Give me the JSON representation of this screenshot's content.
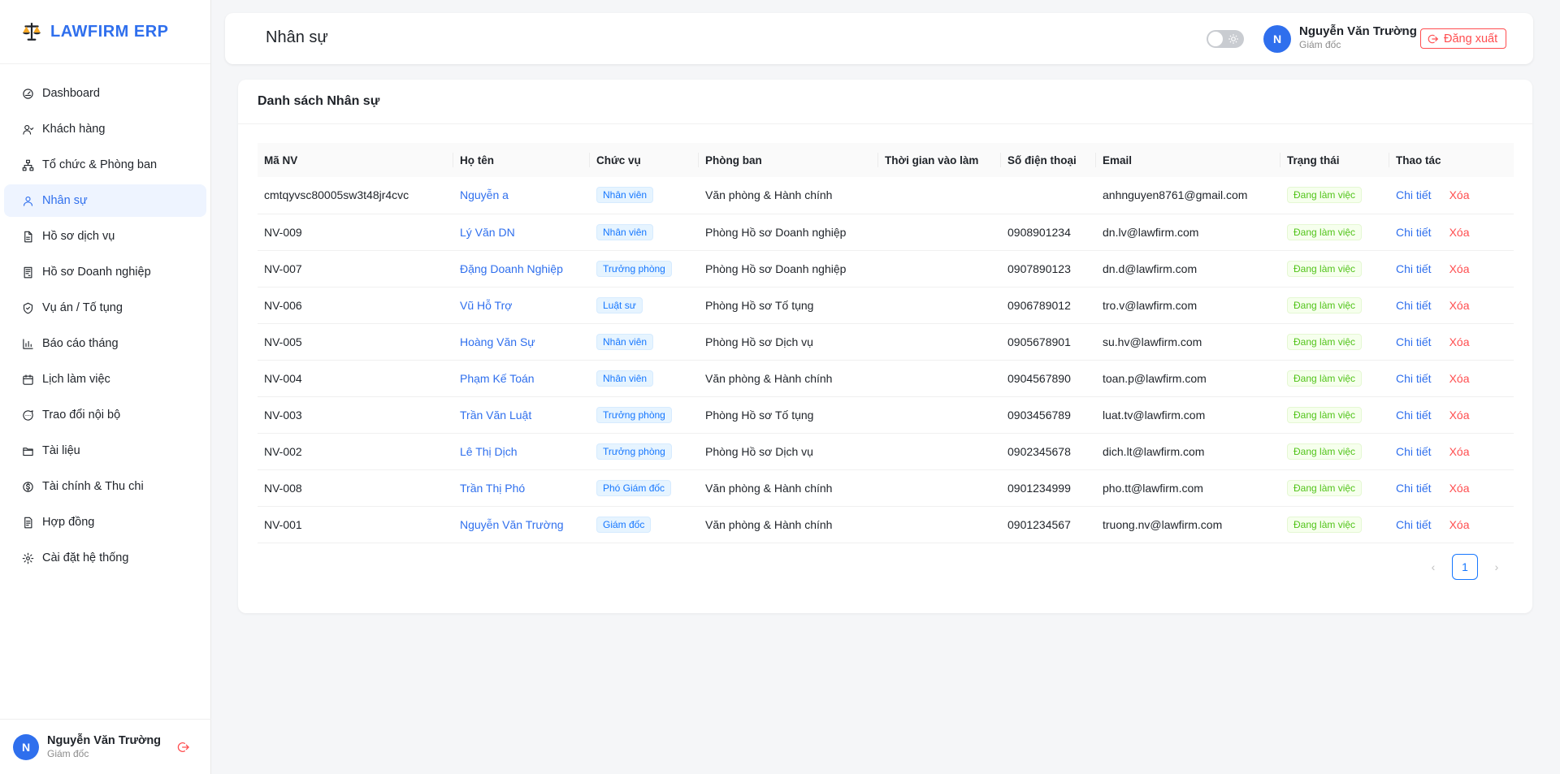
{
  "app": {
    "name": "LAWFIRM ERP"
  },
  "sidebar": {
    "items": [
      {
        "label": "Dashboard",
        "icon": "dashboard-icon"
      },
      {
        "label": "Khách hàng",
        "icon": "customers-icon"
      },
      {
        "label": "Tổ chức & Phòng ban",
        "icon": "org-chart-icon"
      },
      {
        "label": "Nhân sự",
        "icon": "user-icon",
        "active": true
      },
      {
        "label": "Hồ sơ dịch vụ",
        "icon": "file-icon"
      },
      {
        "label": "Hồ sơ Doanh nghiệp",
        "icon": "file-text-icon"
      },
      {
        "label": "Vụ án / Tố tụng",
        "icon": "shield-icon"
      },
      {
        "label": "Báo cáo tháng",
        "icon": "bar-chart-icon"
      },
      {
        "label": "Lịch làm việc",
        "icon": "calendar-icon"
      },
      {
        "label": "Trao đổi nội bộ",
        "icon": "chat-icon"
      },
      {
        "label": "Tài liệu",
        "icon": "folder-icon"
      },
      {
        "label": "Tài chính & Thu chi",
        "icon": "dollar-icon"
      },
      {
        "label": "Hợp đồng",
        "icon": "contract-icon"
      },
      {
        "label": "Cài đặt hệ thống",
        "icon": "settings-icon"
      }
    ],
    "user": {
      "initial": "N",
      "name": "Nguyễn Văn Trường",
      "role": "Giám đốc"
    }
  },
  "header": {
    "title": "Nhân sự",
    "user": {
      "initial": "N",
      "name": "Nguyễn Văn Trường",
      "role": "Giám đốc"
    },
    "logout_label": "Đăng xuất"
  },
  "card": {
    "title": "Danh sách Nhân sự",
    "columns": [
      "Mã NV",
      "Họ tên",
      "Chức vụ",
      "Phòng ban",
      "Thời gian vào làm",
      "Số điện thoại",
      "Email",
      "Trạng thái",
      "Thao tác"
    ],
    "rows": [
      {
        "id": "cmtqyvsc80005sw3t48jr4cvc",
        "name": "Nguyễn a",
        "position": "Nhân viên",
        "department": "Văn phòng & Hành chính",
        "start": "",
        "phone": "",
        "email": "anhnguyen8761@gmail.com",
        "status": "Đang làm việc"
      },
      {
        "id": "NV-009",
        "name": "Lý Văn DN",
        "position": "Nhân viên",
        "department": "Phòng Hồ sơ Doanh nghiệp",
        "start": "",
        "phone": "0908901234",
        "email": "dn.lv@lawfirm.com",
        "status": "Đang làm việc"
      },
      {
        "id": "NV-007",
        "name": "Đặng Doanh Nghiệp",
        "position": "Trưởng phòng",
        "department": "Phòng Hồ sơ Doanh nghiệp",
        "start": "",
        "phone": "0907890123",
        "email": "dn.d@lawfirm.com",
        "status": "Đang làm việc"
      },
      {
        "id": "NV-006",
        "name": "Vũ Hỗ Trợ",
        "position": "Luật sư",
        "department": "Phòng Hồ sơ Tố tụng",
        "start": "",
        "phone": "0906789012",
        "email": "tro.v@lawfirm.com",
        "status": "Đang làm việc"
      },
      {
        "id": "NV-005",
        "name": "Hoàng Văn Sự",
        "position": "Nhân viên",
        "department": "Phòng Hồ sơ Dịch vụ",
        "start": "",
        "phone": "0905678901",
        "email": "su.hv@lawfirm.com",
        "status": "Đang làm việc"
      },
      {
        "id": "NV-004",
        "name": "Phạm Kế Toán",
        "position": "Nhân viên",
        "department": "Văn phòng & Hành chính",
        "start": "",
        "phone": "0904567890",
        "email": "toan.p@lawfirm.com",
        "status": "Đang làm việc"
      },
      {
        "id": "NV-003",
        "name": "Trần Văn Luật",
        "position": "Trưởng phòng",
        "department": "Phòng Hồ sơ Tố tụng",
        "start": "",
        "phone": "0903456789",
        "email": "luat.tv@lawfirm.com",
        "status": "Đang làm việc"
      },
      {
        "id": "NV-002",
        "name": "Lê Thị Dịch",
        "position": "Trưởng phòng",
        "department": "Phòng Hồ sơ Dịch vụ",
        "start": "",
        "phone": "0902345678",
        "email": "dich.lt@lawfirm.com",
        "status": "Đang làm việc"
      },
      {
        "id": "NV-008",
        "name": "Trần Thị Phó",
        "position": "Phó Giám đốc",
        "department": "Văn phòng & Hành chính",
        "start": "",
        "phone": "0901234999",
        "email": "pho.tt@lawfirm.com",
        "status": "Đang làm việc"
      },
      {
        "id": "NV-001",
        "name": "Nguyễn Văn Trường",
        "position": "Giám đốc",
        "department": "Văn phòng & Hành chính",
        "start": "",
        "phone": "0901234567",
        "email": "truong.nv@lawfirm.com",
        "status": "Đang làm việc"
      }
    ],
    "actions": {
      "detail": "Chi tiết",
      "delete": "Xóa"
    },
    "pagination": {
      "current": "1"
    }
  },
  "colors": {
    "accent": "#2f6fed",
    "danger": "#ff4d4f",
    "success": "#52c41a"
  }
}
